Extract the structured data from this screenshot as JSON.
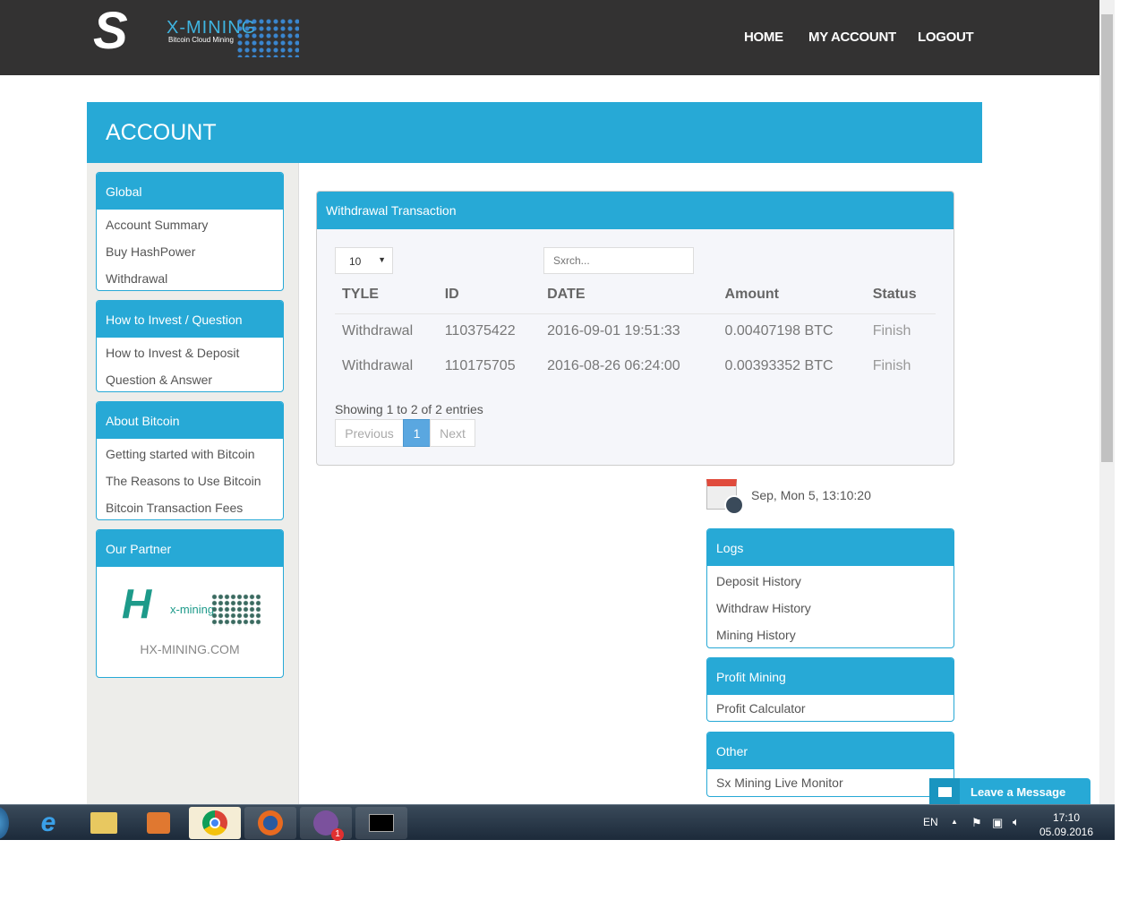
{
  "header": {
    "logo_text": "X-MINING",
    "logo_sub": "Bitcoin Cloud Mining",
    "nav": [
      "HOME",
      "MY ACCOUNT",
      "LOGOUT"
    ]
  },
  "banner": {
    "title": "ACCOUNT"
  },
  "sidebar": [
    {
      "title": "Global",
      "items": [
        "Account Summary",
        "Buy HashPower",
        "Withdrawal"
      ]
    },
    {
      "title": "How to Invest / Question",
      "items": [
        "How to Invest & Deposit",
        "Question & Answer"
      ]
    },
    {
      "title": "About Bitcoin",
      "items": [
        "Getting started with Bitcoin",
        "The Reasons to Use Bitcoin",
        "Bitcoin Transaction Fees"
      ]
    },
    {
      "title": "Our Partner",
      "partner_logo": "X-MINING",
      "partner_url": "HX-MINING.COM"
    }
  ],
  "withdrawal": {
    "title": "Withdrawal Transaction",
    "page_size": "10",
    "search_placeholder": "Sxrch...",
    "columns": [
      "TYLE",
      "ID",
      "DATE",
      "Amount",
      "Status"
    ],
    "rows": [
      [
        "Withdrawal",
        "110375422",
        "2016-09-01 19:51:33",
        "0.00407198 BTC",
        "Finish"
      ],
      [
        "Withdrawal",
        "110175705",
        "2016-08-26 06:24:00",
        "0.00393352 BTC",
        "Finish"
      ]
    ],
    "info": "Showing 1 to 2 of 2 entries",
    "prev": "Previous",
    "page": "1",
    "next": "Next"
  },
  "clock": "Sep, Mon 5, 13:10:20",
  "right": [
    {
      "title": "Logs",
      "items": [
        "Deposit History",
        "Withdraw History",
        "Mining History"
      ]
    },
    {
      "title": "Profit Mining",
      "items": [
        "Profit Calculator"
      ]
    },
    {
      "title": "Other",
      "items": [
        "Sx Mining Live Monitor"
      ]
    }
  ],
  "chat": {
    "label": "Leave a Message"
  },
  "taskbar": {
    "lang": "EN",
    "time": "17:10",
    "date": "05.09.2016",
    "viber_badge": "1"
  }
}
